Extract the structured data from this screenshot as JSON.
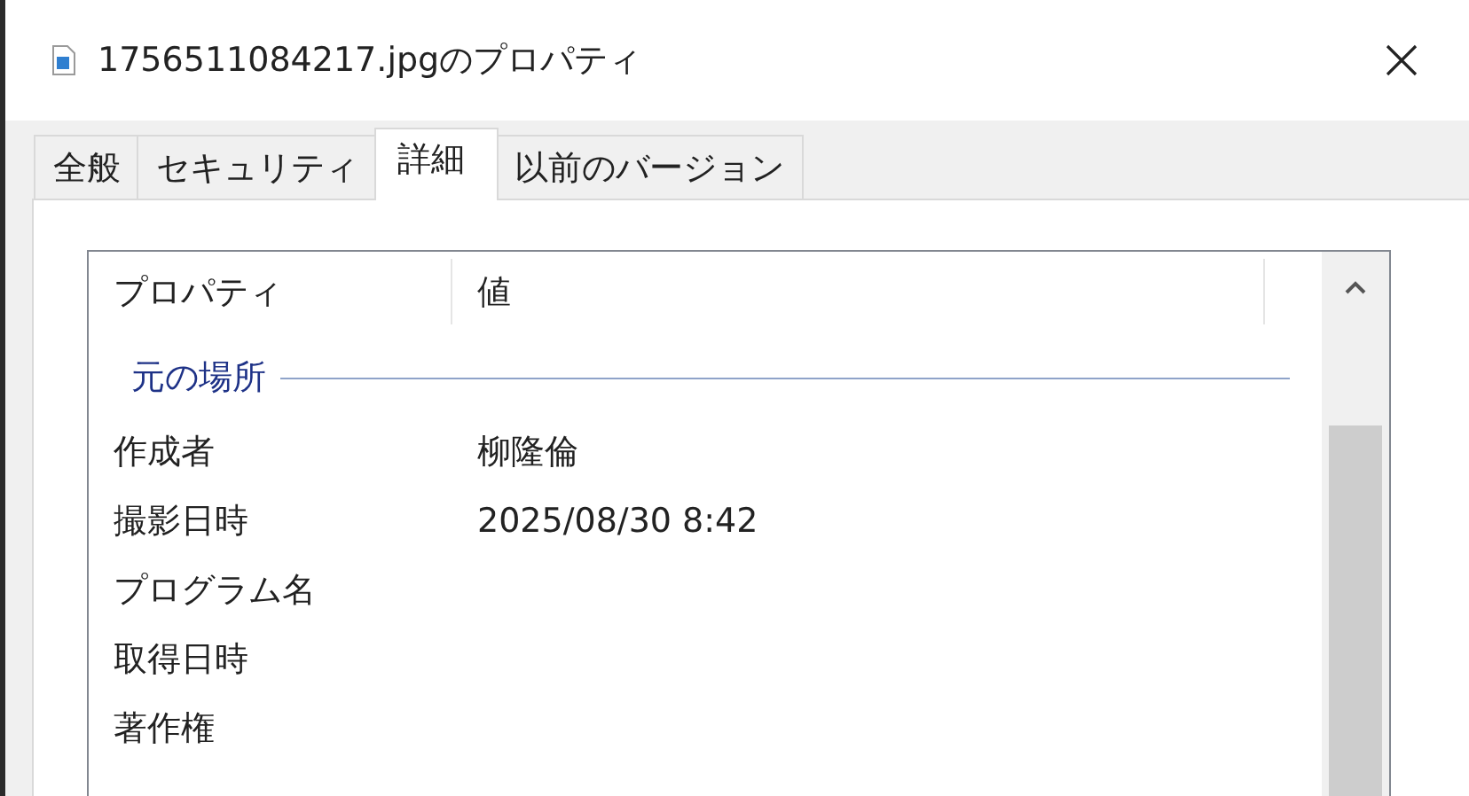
{
  "window": {
    "title": "1756511084217.jpgのプロパティ"
  },
  "tabs": [
    {
      "label": "全般",
      "selected": false
    },
    {
      "label": "セキュリティ",
      "selected": false
    },
    {
      "label": "詳細",
      "selected": true
    },
    {
      "label": "以前のバージョン",
      "selected": false
    }
  ],
  "table": {
    "columns": [
      "プロパティ",
      "値"
    ],
    "group": "元の場所",
    "rows": [
      {
        "property": "作成者",
        "value": "柳隆倫"
      },
      {
        "property": "撮影日時",
        "value": "2025/08/30 8:42"
      },
      {
        "property": "プログラム名"
      },
      {
        "property": "取得日時"
      },
      {
        "property": "著作権"
      }
    ]
  }
}
